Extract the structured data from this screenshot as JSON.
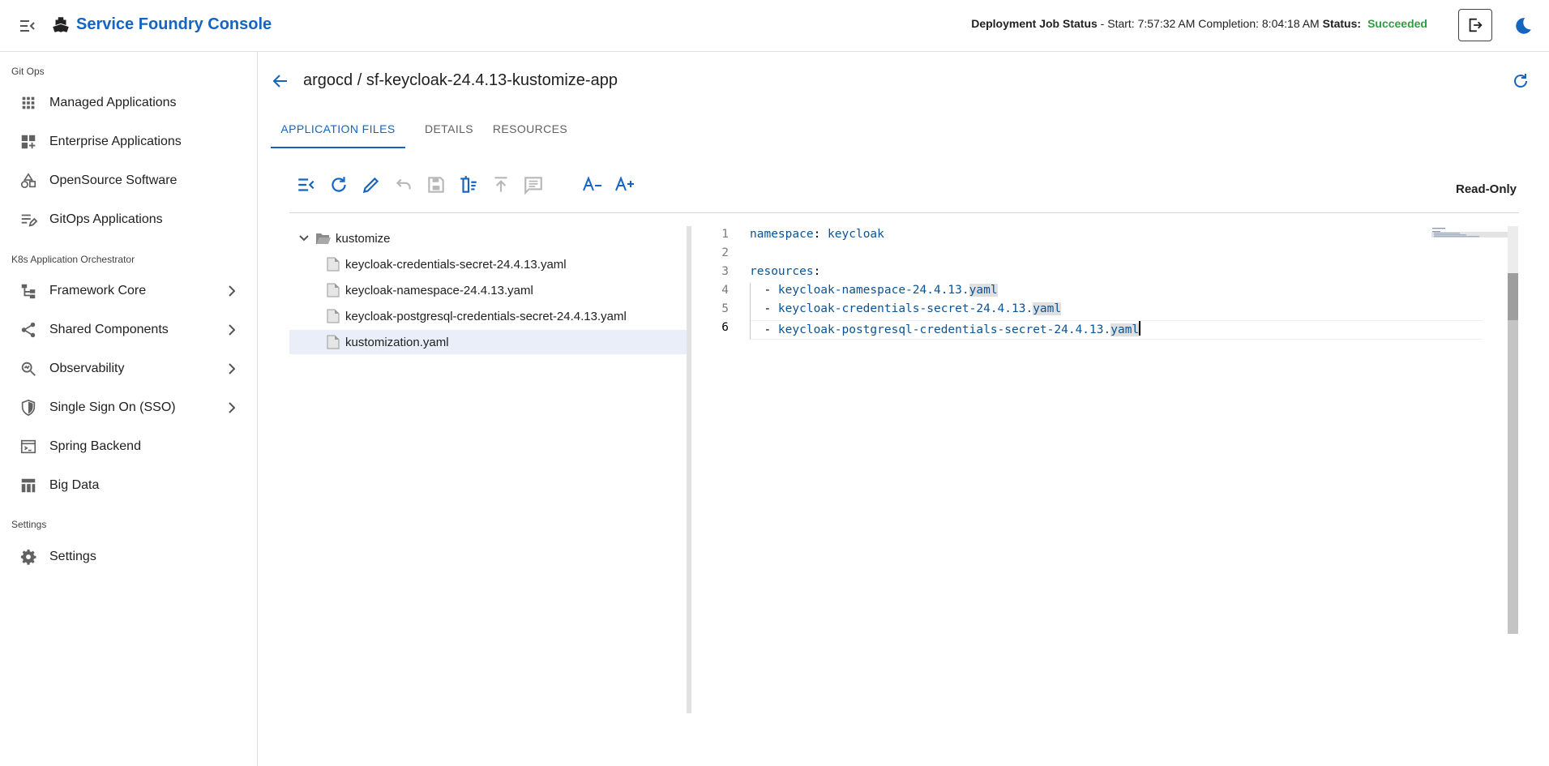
{
  "header": {
    "app_title": "Service Foundry Console",
    "job_status_label": "Deployment Job Status",
    "job_status_times": " - Start: 7:57:32 AM Completion: 8:04:18 AM ",
    "status_label": "Status:",
    "status_value": "Succeeded",
    "status_color": "#2e9e3e",
    "brand_color": "#1565c0"
  },
  "sidebar": {
    "sections": [
      {
        "label": "Git Ops",
        "items": [
          {
            "label": "Managed Applications",
            "icon": "grid-icon"
          },
          {
            "label": "Enterprise Applications",
            "icon": "dashboard-add-icon"
          },
          {
            "label": "OpenSource Software",
            "icon": "shapes-icon"
          },
          {
            "label": "GitOps Applications",
            "icon": "playlist-edit-icon"
          }
        ]
      },
      {
        "label": "K8s Application Orchestrator",
        "items": [
          {
            "label": "Framework Core",
            "icon": "hierarchy-icon"
          },
          {
            "label": "Shared Components",
            "icon": "share-icon"
          },
          {
            "label": "Observability",
            "icon": "search-insights-icon"
          },
          {
            "label": "Single Sign On (SSO)",
            "icon": "shield-icon"
          },
          {
            "label": "Spring Backend",
            "icon": "terminal-icon"
          },
          {
            "label": "Big Data",
            "icon": "table-icon"
          }
        ]
      },
      {
        "label": "Settings",
        "items": [
          {
            "label": "Settings",
            "icon": "gear-icon"
          }
        ]
      }
    ]
  },
  "main": {
    "title": "argocd / sf-keycloak-24.4.13-kustomize-app",
    "tabs": [
      "APPLICATION FILES",
      "DETAILS",
      "RESOURCES"
    ],
    "active_tab": "APPLICATION FILES",
    "mode_label": "Read-Only",
    "toolbar_icons": [
      "collapse-icon",
      "reload-icon",
      "edit-icon",
      "undo-icon",
      "save-icon",
      "delete-icon",
      "upload-icon",
      "comment-icon",
      "font-decrease-icon",
      "font-increase-icon"
    ]
  },
  "tree": {
    "folder": "kustomize",
    "files": [
      "keycloak-credentials-secret-24.4.13.yaml",
      "keycloak-namespace-24.4.13.yaml",
      "keycloak-postgresql-credentials-secret-24.4.13.yaml",
      "kustomization.yaml"
    ],
    "selected_file": "kustomization.yaml"
  },
  "editor": {
    "line_numbers": [
      "1",
      "2",
      "3",
      "4",
      "5",
      "6"
    ],
    "current_line": "6",
    "namespace_key": "namespace",
    "namespace_value": "keycloak",
    "resources_key": "resources",
    "resources": [
      {
        "name": "keycloak-namespace-24.4.13.",
        "ext": "yaml"
      },
      {
        "name": "keycloak-credentials-secret-24.4.13.",
        "ext": "yaml"
      },
      {
        "name": "keycloak-postgresql-credentials-secret-24.4.13.",
        "ext": "yaml"
      }
    ]
  }
}
